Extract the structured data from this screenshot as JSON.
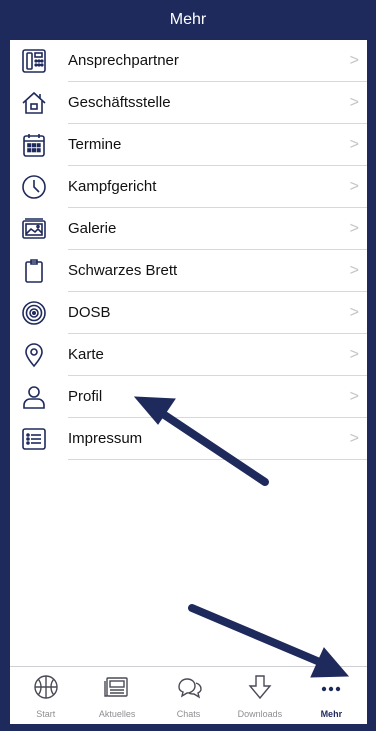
{
  "header": {
    "title": "Mehr"
  },
  "menu": [
    {
      "label": "Ansprechpartner",
      "icon": "phonebook-icon"
    },
    {
      "label": "Geschäftsstelle",
      "icon": "home-icon"
    },
    {
      "label": "Termine",
      "icon": "calendar-icon"
    },
    {
      "label": "Kampfgericht",
      "icon": "clock-icon"
    },
    {
      "label": "Galerie",
      "icon": "gallery-icon"
    },
    {
      "label": "Schwarzes Brett",
      "icon": "clipboard-icon"
    },
    {
      "label": "DOSB",
      "icon": "target-icon"
    },
    {
      "label": "Karte",
      "icon": "map-pin-icon"
    },
    {
      "label": "Profil",
      "icon": "user-icon"
    },
    {
      "label": "Impressum",
      "icon": "list-icon"
    }
  ],
  "chevron": ">",
  "tabs": [
    {
      "label": "Start",
      "icon": "basketball-icon"
    },
    {
      "label": "Aktuelles",
      "icon": "newspaper-icon"
    },
    {
      "label": "Chats",
      "icon": "chat-bubbles-icon"
    },
    {
      "label": "Downloads",
      "icon": "download-arrow-icon"
    },
    {
      "label": "Mehr",
      "icon": "more-dots-icon",
      "active": true
    }
  ],
  "colors": {
    "brand": "#1f2a5c",
    "chevron": "#c4c4c8",
    "separator": "#d8d8dc",
    "tab_inactive": "#8e8e93"
  }
}
